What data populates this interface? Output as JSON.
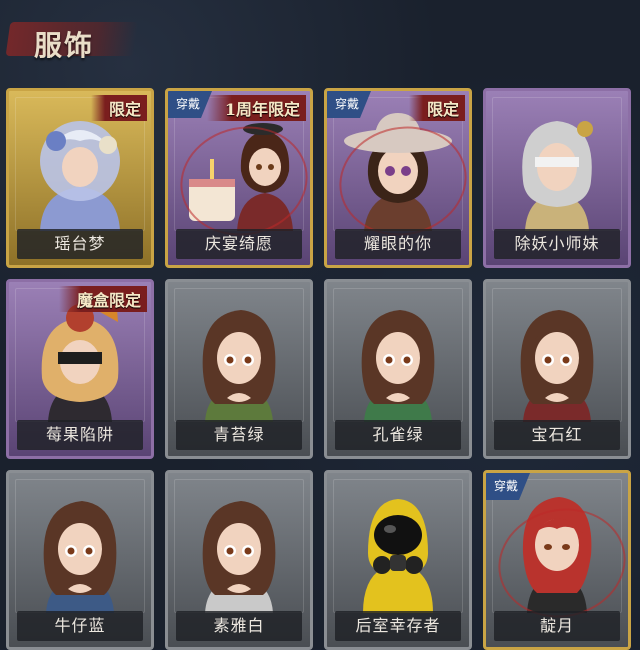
{
  "header": {
    "title": "服饰"
  },
  "cards": [
    {
      "name": "瑶台梦",
      "rarity": "legend",
      "limited_tag": "限定",
      "worn_tag": "",
      "art": "ornate-figure-icon",
      "art_color": "#b9c3e8"
    },
    {
      "name": "庆宴绮愿",
      "rarity": "purple-gold",
      "limited_tag": "1周年限定",
      "worn_tag": "穿戴",
      "art": "cake-girl-icon",
      "art_color": "#e6a06a"
    },
    {
      "name": "耀眼的你",
      "rarity": "purple-gold",
      "limited_tag": "限定",
      "worn_tag": "穿戴",
      "art": "cowboy-hat-girl-icon",
      "art_color": "#d7c9c1"
    },
    {
      "name": "除妖小师妹",
      "rarity": "purple",
      "limited_tag": "",
      "worn_tag": "",
      "art": "blindfold-girl-icon",
      "art_color": "#cfcfcf"
    },
    {
      "name": "莓果陷阱",
      "rarity": "purple",
      "limited_tag": "魔盒限定",
      "worn_tag": "",
      "art": "berry-girl-icon",
      "art_color": "#e0b06a"
    },
    {
      "name": "青苔绿",
      "rarity": "grey",
      "limited_tag": "",
      "worn_tag": "",
      "art": "brown-hair-girl-icon",
      "art_color": "#5d7a3c"
    },
    {
      "name": "孔雀绿",
      "rarity": "grey",
      "limited_tag": "",
      "worn_tag": "",
      "art": "brown-hair-girl-icon",
      "art_color": "#3f7a4a"
    },
    {
      "name": "宝石红",
      "rarity": "grey",
      "limited_tag": "",
      "worn_tag": "",
      "art": "brown-hair-girl-icon",
      "art_color": "#7a2a2a"
    },
    {
      "name": "牛仔蓝",
      "rarity": "grey",
      "limited_tag": "",
      "worn_tag": "",
      "art": "brown-hair-girl-icon",
      "art_color": "#3d5a86"
    },
    {
      "name": "素雅白",
      "rarity": "grey",
      "limited_tag": "",
      "worn_tag": "",
      "art": "brown-hair-girl-icon",
      "art_color": "#c9c9c9"
    },
    {
      "name": "后室幸存者",
      "rarity": "grey",
      "limited_tag": "",
      "worn_tag": "",
      "art": "gas-mask-icon",
      "art_color": "#e3c21e"
    },
    {
      "name": "靛月",
      "rarity": "grey-gold",
      "limited_tag": "",
      "worn_tag": "穿戴",
      "art": "red-hair-icon",
      "art_color": "#b9332d"
    }
  ]
}
